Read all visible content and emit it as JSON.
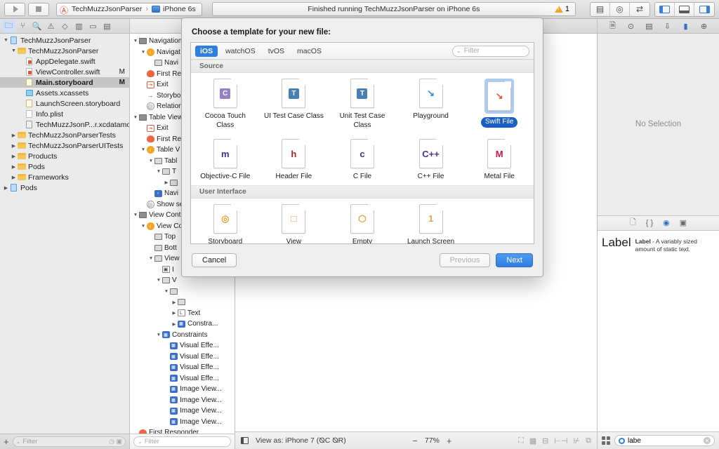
{
  "toolbar": {
    "run_label": "Run",
    "stop_label": "Stop",
    "scheme_name": "TechMuzzJsonParser",
    "scheme_separator": "›",
    "destination": "iPhone 6s",
    "activity_text": "Finished running TechMuzzJsonParser on iPhone 6s",
    "warning_count": "1",
    "editor_standard": "standard-editor",
    "editor_assistant": "assistant-editor",
    "editor_version": "version-editor",
    "view_navigator": "hide-navigator",
    "view_debug": "hide-debug-area",
    "view_utilities": "hide-utilities"
  },
  "navigator": {
    "tabs": [
      "folder",
      "source-control",
      "search",
      "issue",
      "test",
      "debug",
      "breakpoint",
      "report"
    ],
    "active_tab_index": 0,
    "tree": [
      {
        "label": "TechMuzzJsonParser",
        "indent": 0,
        "disc": "▼",
        "icon": "project",
        "flag": "",
        "selected": false
      },
      {
        "label": "TechMuzzJsonParser",
        "indent": 1,
        "disc": "▼",
        "icon": "folder",
        "flag": "",
        "selected": false
      },
      {
        "label": "AppDelegate.swift",
        "indent": 2,
        "disc": "",
        "icon": "swift",
        "flag": "",
        "selected": false
      },
      {
        "label": "ViewController.swift",
        "indent": 2,
        "disc": "",
        "icon": "swift",
        "flag": "M",
        "selected": false
      },
      {
        "label": "Main.storyboard",
        "indent": 2,
        "disc": "",
        "icon": "storyboard",
        "flag": "M",
        "selected": true
      },
      {
        "label": "Assets.xcassets",
        "indent": 2,
        "disc": "",
        "icon": "xcassets",
        "flag": "",
        "selected": false
      },
      {
        "label": "LaunchScreen.storyboard",
        "indent": 2,
        "disc": "",
        "icon": "storyboard",
        "flag": "",
        "selected": false
      },
      {
        "label": "Info.plist",
        "indent": 2,
        "disc": "",
        "icon": "plist",
        "flag": "",
        "selected": false
      },
      {
        "label": "TechMuzzJsonP...r.xcdatamodeld",
        "indent": 2,
        "disc": "",
        "icon": "datamodel",
        "flag": "",
        "selected": false
      },
      {
        "label": "TechMuzzJsonParserTests",
        "indent": 1,
        "disc": "▶",
        "icon": "folder",
        "flag": "",
        "selected": false
      },
      {
        "label": "TechMuzzJsonParserUITests",
        "indent": 1,
        "disc": "▶",
        "icon": "folder",
        "flag": "",
        "selected": false
      },
      {
        "label": "Products",
        "indent": 1,
        "disc": "▶",
        "icon": "folder",
        "flag": "",
        "selected": false
      },
      {
        "label": "Pods",
        "indent": 1,
        "disc": "▶",
        "icon": "folder",
        "flag": "",
        "selected": false
      },
      {
        "label": "Frameworks",
        "indent": 1,
        "disc": "▶",
        "icon": "folder",
        "flag": "",
        "selected": false
      },
      {
        "label": "Pods",
        "indent": 0,
        "disc": "▶",
        "icon": "project",
        "flag": "",
        "selected": false
      }
    ],
    "filter_placeholder": "Filter",
    "add_label": "+"
  },
  "outline": {
    "tree": [
      {
        "label": "Navigation",
        "indent": 0,
        "disc": "▼",
        "icon": "scene"
      },
      {
        "label": "Navigat",
        "indent": 1,
        "disc": "▼",
        "icon": "vc-orange"
      },
      {
        "label": "Navi",
        "indent": 2,
        "disc": "",
        "icon": "bar"
      },
      {
        "label": "First Re",
        "indent": 1,
        "disc": "",
        "icon": "responder"
      },
      {
        "label": "Exit",
        "indent": 1,
        "disc": "",
        "icon": "exit"
      },
      {
        "label": "Storybo",
        "indent": 1,
        "disc": "",
        "icon": "entry"
      },
      {
        "label": "Relation",
        "indent": 1,
        "disc": "",
        "icon": "relation"
      },
      {
        "label": "Table View",
        "indent": 0,
        "disc": "▼",
        "icon": "scene"
      },
      {
        "label": "Exit",
        "indent": 1,
        "disc": "",
        "icon": "exit"
      },
      {
        "label": "First Re",
        "indent": 1,
        "disc": "",
        "icon": "responder"
      },
      {
        "label": "Table V",
        "indent": 1,
        "disc": "▼",
        "icon": "vc-orange"
      },
      {
        "label": "Tabl",
        "indent": 2,
        "disc": "▼",
        "icon": "view"
      },
      {
        "label": "T",
        "indent": 3,
        "disc": "▼",
        "icon": "view"
      },
      {
        "label": "",
        "indent": 4,
        "disc": "▶",
        "icon": "view"
      },
      {
        "label": "Navi",
        "indent": 2,
        "disc": "",
        "icon": "navitem"
      },
      {
        "label": "Show se",
        "indent": 1,
        "disc": "",
        "icon": "relation"
      },
      {
        "label": "View Cont",
        "indent": 0,
        "disc": "▼",
        "icon": "scene"
      },
      {
        "label": "View Co",
        "indent": 1,
        "disc": "▼",
        "icon": "vc-orange"
      },
      {
        "label": "Top",
        "indent": 2,
        "disc": "",
        "icon": "guide"
      },
      {
        "label": "Bott",
        "indent": 2,
        "disc": "",
        "icon": "guide"
      },
      {
        "label": "View",
        "indent": 2,
        "disc": "▼",
        "icon": "view"
      },
      {
        "label": "I",
        "indent": 3,
        "disc": "",
        "icon": "imageview"
      },
      {
        "label": "V",
        "indent": 3,
        "disc": "▼",
        "icon": "visualeffect"
      },
      {
        "label": "",
        "indent": 4,
        "disc": "▼",
        "icon": "view"
      },
      {
        "label": "",
        "indent": 5,
        "disc": "▶",
        "icon": "view"
      },
      {
        "label": "Text",
        "indent": 5,
        "disc": "▶",
        "icon": "label"
      },
      {
        "label": "Constra...",
        "indent": 5,
        "disc": "▶",
        "icon": "constraint"
      },
      {
        "label": "Constraints",
        "indent": 3,
        "disc": "▼",
        "icon": "constraint"
      },
      {
        "label": "Visual Effe...",
        "indent": 4,
        "disc": "",
        "icon": "constraint"
      },
      {
        "label": "Visual Effe...",
        "indent": 4,
        "disc": "",
        "icon": "constraint"
      },
      {
        "label": "Visual Effe...",
        "indent": 4,
        "disc": "",
        "icon": "constraint"
      },
      {
        "label": "Visual Effe...",
        "indent": 4,
        "disc": "",
        "icon": "constraint"
      },
      {
        "label": "Image View...",
        "indent": 4,
        "disc": "",
        "icon": "constraint"
      },
      {
        "label": "Image View...",
        "indent": 4,
        "disc": "",
        "icon": "constraint"
      },
      {
        "label": "Image View...",
        "indent": 4,
        "disc": "",
        "icon": "constraint"
      },
      {
        "label": "Image View...",
        "indent": 4,
        "disc": "",
        "icon": "constraint"
      },
      {
        "label": "First Responder",
        "indent": 0,
        "disc": "",
        "icon": "responder"
      },
      {
        "label": "Exit",
        "indent": 0,
        "disc": "",
        "icon": "exit"
      }
    ],
    "filter_placeholder": "Filter"
  },
  "canvas": {
    "view_as_label": "View as: iPhone 7 (⦰C ⦰R)",
    "zoom_minus": "−",
    "zoom_level": "77%",
    "zoom_plus": "+"
  },
  "inspector": {
    "tabs": [
      "file-inspector",
      "quick-help",
      "identity-inspector",
      "attributes-inspector",
      "size-inspector",
      "connections-inspector"
    ],
    "active_tab_index": 4,
    "no_selection": "No Selection"
  },
  "library": {
    "tabs": [
      "file-template-library",
      "code-snippet-library",
      "object-library",
      "media-library"
    ],
    "active_tab_index": 2,
    "items": [
      {
        "title": "Label",
        "name": "Label",
        "description": " - A variably sized amount of static text."
      }
    ],
    "filter_value": "labe",
    "filter_placeholder": "Filter"
  },
  "modal": {
    "title": "Choose a template for your new file:",
    "platform_tabs": [
      "iOS",
      "watchOS",
      "tvOS",
      "macOS"
    ],
    "active_platform_index": 0,
    "filter_placeholder": "Filter",
    "sections": [
      {
        "header": "Source",
        "rows": [
          [
            {
              "label": "Cocoa Touch Class",
              "icon": "doc-C",
              "badge": "C",
              "badge_color": "#9b7fc4",
              "selected": false
            },
            {
              "label": "UI Test Case Class",
              "icon": "doc-T",
              "badge": "T",
              "badge_color": "#4a7fb5",
              "selected": false
            },
            {
              "label": "Unit Test Case Class",
              "icon": "doc-T",
              "badge": "T",
              "badge_color": "#4a7fb5",
              "selected": false
            },
            {
              "label": "Playground",
              "icon": "doc-swift-blue",
              "badge": "↘",
              "badge_color": "#2f8fe0",
              "selected": false
            },
            {
              "label": "Swift File",
              "icon": "doc-swift-orange",
              "badge": "↘",
              "badge_color": "#e8542e",
              "selected": true
            }
          ],
          [
            {
              "label": "Objective-C File",
              "icon": "doc-m",
              "badge": "m",
              "badge_color": "#4a2f8f",
              "selected": false
            },
            {
              "label": "Header File",
              "icon": "doc-h",
              "badge": "h",
              "badge_color": "#b51f2a",
              "selected": false
            },
            {
              "label": "C File",
              "icon": "doc-c",
              "badge": "c",
              "badge_color": "#4a2f8f",
              "selected": false
            },
            {
              "label": "C++ File",
              "icon": "doc-cpp",
              "badge": "C++",
              "badge_color": "#4a2f8f",
              "selected": false
            },
            {
              "label": "Metal File",
              "icon": "doc-metal",
              "badge": "M",
              "badge_color": "#c9174a",
              "selected": false
            }
          ]
        ]
      },
      {
        "header": "User Interface",
        "rows": [
          [
            {
              "label": "Storyboard",
              "icon": "doc-storyboard",
              "badge": "◎",
              "badge_color": "#e8a33d",
              "selected": false
            },
            {
              "label": "View",
              "icon": "doc-view",
              "badge": "□",
              "badge_color": "#e8a33d",
              "selected": false
            },
            {
              "label": "Empty",
              "icon": "doc-empty",
              "badge": "⬡",
              "badge_color": "#e8a33d",
              "selected": false
            },
            {
              "label": "Launch Screen",
              "icon": "doc-launch",
              "badge": "1",
              "badge_color": "#e8a33d",
              "selected": false
            },
            {
              "label": "",
              "icon": "",
              "badge": "",
              "badge_color": "",
              "selected": false
            }
          ]
        ]
      }
    ],
    "cancel_label": "Cancel",
    "previous_label": "Previous",
    "next_label": "Next"
  },
  "colors": {
    "accent_blue": "#2f7fe0",
    "selection_blue": "#1a5fc4",
    "warning_orange": "#f3a423",
    "swift_orange": "#e8542e"
  }
}
